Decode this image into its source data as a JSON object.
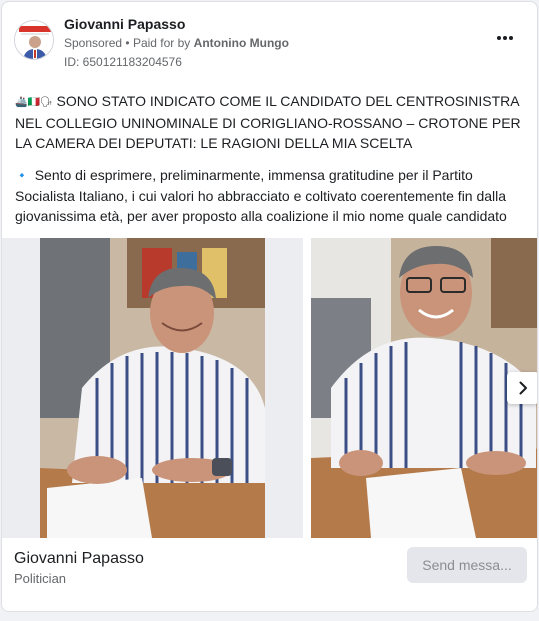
{
  "ad": {
    "page_name": "Giovanni Papasso",
    "sponsored": "Sponsored",
    "paid_for_prefix": "Paid for by",
    "payer": "Antonino Mungo",
    "library_id": "ID: 650121183204576",
    "more_icon": "more-options-icon"
  },
  "post": {
    "prefix_icons": "🚢🇮🇹🗣",
    "headline": "SONO STATO INDICATO COME IL CANDIDATO DEL CENTROSINISTRA NEL COLLEGIO UNINOMINALE DI CORIGLIANO-ROSSANO – CROTONE PER LA CAMERA DEI DEPUTATI: LE RAGIONI DELLA MIA SCELTA",
    "bullet_icon": "🔹",
    "body": "Sento di esprimere, preliminarmente, immensa gratitudine per il Partito Socialista Italiano, i cui valori ho abbracciato e coltivato coerentemente fin dalla giovanissima età, per aver proposto alla coalizione il mio nome quale candidato a…"
  },
  "carousel": {
    "slides": [
      {
        "alt": "man signing document"
      },
      {
        "alt": "man smiling at desk"
      }
    ],
    "next_icon": "chevron-right-icon"
  },
  "footer": {
    "name": "Giovanni Papasso",
    "category": "Politician",
    "cta_label": "Send messa..."
  },
  "colors": {
    "link_blue": "#1877f2",
    "secondary_text": "#65676b",
    "button_bg": "#e4e6eb"
  }
}
